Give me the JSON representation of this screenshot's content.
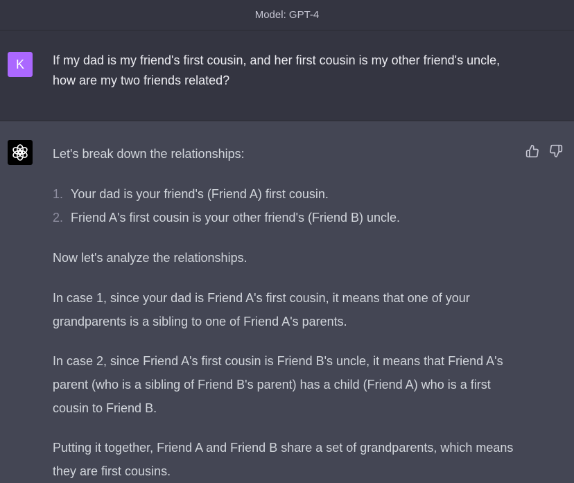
{
  "header": {
    "model_label": "Model: GPT-4"
  },
  "user_message": {
    "avatar_letter": "K",
    "text": "If my dad is my friend's first cousin, and her first cousin is my other friend's uncle, how are my two friends related?"
  },
  "assistant_message": {
    "avatar_icon": "openai-logo-icon",
    "feedback": {
      "thumbs_up_icon": "thumbs-up-icon",
      "thumbs_down_icon": "thumbs-down-icon"
    },
    "intro": "Let's break down the relationships:",
    "list": [
      {
        "number": "1.",
        "text": "Your dad is your friend's (Friend A) first cousin."
      },
      {
        "number": "2.",
        "text": "Friend A's first cousin is your other friend's (Friend B) uncle."
      }
    ],
    "paragraphs": [
      "Now let's analyze the relationships.",
      "In case 1, since your dad is Friend A's first cousin, it means that one of your grandparents is a sibling to one of Friend A's parents.",
      "In case 2, since Friend A's first cousin is Friend B's uncle, it means that Friend A's parent (who is a sibling of Friend B's parent) has a child (Friend A) who is a first cousin to Friend B.",
      "Putting it together, Friend A and Friend B share a set of grandparents, which means they are first cousins."
    ]
  },
  "colors": {
    "user_bg": "#343541",
    "assistant_bg": "#444654",
    "user_avatar": "#ab68ff",
    "gpt_avatar": "#000000"
  }
}
